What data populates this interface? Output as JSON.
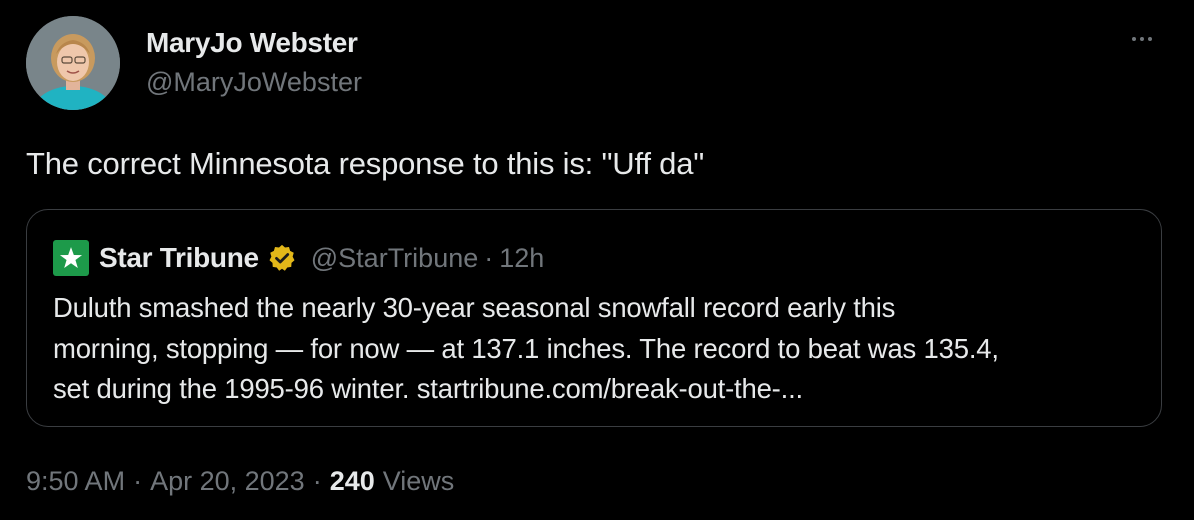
{
  "author": {
    "display_name": "MaryJo Webster",
    "handle": "@MaryJoWebster"
  },
  "tweet": {
    "text": "The correct Minnesota response to this is: \"Uff da\""
  },
  "quoted_tweet": {
    "display_name": "Star Tribune",
    "handle": "@StarTribune",
    "separator": "·",
    "time": "12h",
    "text_lines": [
      "Duluth smashed the nearly 30-year seasonal snowfall record early this",
      "morning, stopping — for now — at 137.1 inches. The record to beat was 135.4,",
      "set during the 1995-96 winter. startribune.com/break-out-the-..."
    ]
  },
  "meta": {
    "time": "9:50 AM",
    "sep1": "·",
    "date": "Apr 20, 2023",
    "sep2": "·",
    "views_count": "240",
    "views_label": "Views"
  },
  "icons": {
    "more": "more-dots-icon",
    "verified": "verified-badge-icon",
    "logo": "star-tribune-logo-icon"
  },
  "colors": {
    "background": "#000000",
    "primary_text": "#e7e9ea",
    "secondary_text": "#71767b",
    "border": "#3a3d41",
    "verified_gold": "#e2b719",
    "logo_green": "#1d9a4a"
  }
}
